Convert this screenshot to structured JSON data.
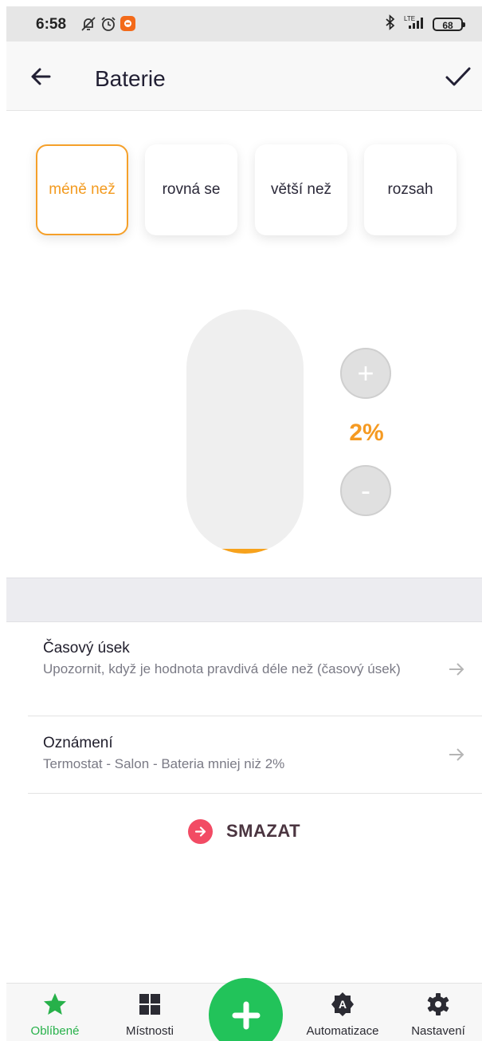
{
  "status_bar": {
    "time": "6:58",
    "battery": "68",
    "network": "LTE"
  },
  "header": {
    "title": "Baterie"
  },
  "conditions": [
    {
      "label": "méně než",
      "active": true
    },
    {
      "label": "rovná se",
      "active": false
    },
    {
      "label": "větší než",
      "active": false
    },
    {
      "label": "rozsah",
      "active": false
    }
  ],
  "slider": {
    "value_label": "2%",
    "value_percent": 2,
    "increase_label": "+",
    "decrease_label": "-"
  },
  "settings": {
    "time_period": {
      "title": "Časový úsek",
      "subtitle": "Upozornit, když je hodnota pravdivá déle než (časový úsek)"
    },
    "notification": {
      "title": "Oznámení",
      "subtitle": "Termostat - Salon - Bateria  mniej niż 2%"
    }
  },
  "delete_label": "SMAZAT",
  "bottom_nav": {
    "favorites": "Oblíbené",
    "rooms": "Místnosti",
    "automation": "Automatizace",
    "settings": "Nastavení"
  },
  "colors": {
    "accent": "#f5a02a",
    "active_nav": "#27b14a",
    "fab": "#22c35a",
    "delete": "#f24b64"
  }
}
